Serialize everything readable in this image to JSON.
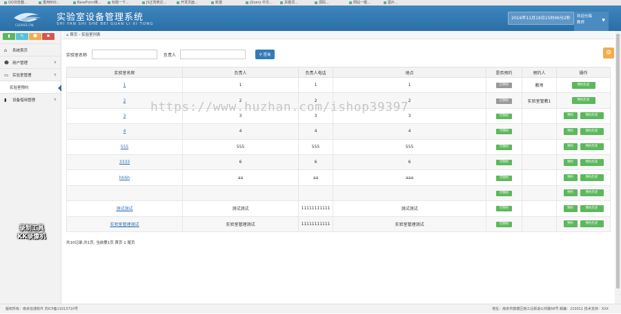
{
  "browser_tabs": [
    "QQ浏览器...",
    "重用BS0...",
    "BaseForm推...",
    "标题一下...",
    "JS正则表达...",
    "开发页面...",
    "新建",
    "jQuery 中文...",
    "关键词...",
    "源码...",
    "网站一键...",
    "图片..."
  ],
  "header": {
    "title": "实验室设备管理系统",
    "subtitle": "SHI YAN SHI SHE BEI GUAN LI XI TONG",
    "datetime": "2016年11月19日15时46分2秒",
    "user_line1": "欢迎光临",
    "user_line2": "教师"
  },
  "sidebar": {
    "items": [
      {
        "label": "系统首页",
        "icon": "home-icon"
      },
      {
        "label": "用户管理",
        "icon": "users-icon"
      },
      {
        "label": "实验室管理",
        "icon": "monitor-icon"
      },
      {
        "label": "实验室预约",
        "icon": "dot-icon"
      },
      {
        "label": "设备借用管理",
        "icon": "bookmark-icon"
      }
    ]
  },
  "watermark_badge": {
    "line1": "录制工具",
    "line2": "KK录像机"
  },
  "breadcrumb": {
    "home": "首页",
    "current": "实验室列表"
  },
  "search": {
    "name_label": "实验室名称",
    "person_label": "负责人",
    "button": "查询"
  },
  "table": {
    "headers": [
      "实验室名称",
      "负责人",
      "负责人电话",
      "地点",
      "是否预约",
      "预约人",
      "操作"
    ],
    "rows": [
      {
        "name": "1",
        "person": "1",
        "phone": "1",
        "place": "1",
        "status": "已预约",
        "reserver": "教师",
        "reserve_btn": false
      },
      {
        "name": "2",
        "person": "2",
        "phone": "2",
        "place": "2",
        "status": "已预约",
        "reserver": "实验室管教1",
        "reserve_btn": false
      },
      {
        "name": "3",
        "person": "3",
        "phone": "3",
        "place": "3",
        "status": "可预约",
        "reserver": "",
        "reserve_btn": true
      },
      {
        "name": "4",
        "person": "4",
        "phone": "4",
        "place": "4",
        "status": "可预约",
        "reserver": "",
        "reserve_btn": true
      },
      {
        "name": "555",
        "person": "555",
        "phone": "555",
        "place": "555",
        "status": "可预约",
        "reserver": "",
        "reserve_btn": true
      },
      {
        "name": "3333",
        "person": "6",
        "phone": "6",
        "place": "6",
        "status": "可预约",
        "reserver": "",
        "reserve_btn": true
      },
      {
        "name": "hhhh",
        "person": "aa",
        "phone": "aa",
        "place": "aaa",
        "status": "可预约",
        "reserver": "",
        "reserve_btn": true
      },
      {
        "name": "",
        "person": "",
        "phone": "",
        "place": "",
        "status": "可预约",
        "reserver": "",
        "reserve_btn": true
      },
      {
        "name": "测试测试",
        "person": "测试测试",
        "phone": "11111111111",
        "place": "测试测试",
        "status": "可预约",
        "reserver": "",
        "reserve_btn": true
      },
      {
        "name": "实验室管理测试",
        "person": "实验室管理测试",
        "phone": "11111111111",
        "place": "实验室管理测试",
        "status": "可预约",
        "reserver": "",
        "reserve_btn": true
      }
    ],
    "reserve_label": "预约",
    "history_label": "预约历史"
  },
  "pager": "共10记录,共1页, 当前第1页 首页 1 尾页",
  "footer": {
    "left": "版权所有：南京信通软件  苏ICP备11013710号",
    "right": "地址：南京市鼓楼区南江北街道公共路58号  邮编：210011  技术支持：XXX"
  },
  "url_watermark": "https://www.huzhan.com/ishop39397",
  "colors": {
    "header": "#2c6ea6",
    "green": "#5cb85c",
    "primary": "#337ab7",
    "gray_tag": "#999999"
  }
}
